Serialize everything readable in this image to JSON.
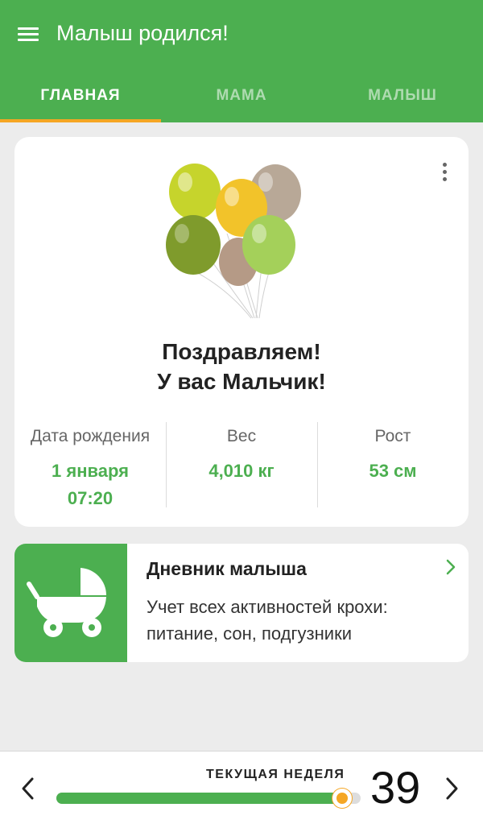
{
  "app": {
    "title": "Малыш родился!"
  },
  "tabs": [
    {
      "label": "ГЛАВНАЯ",
      "active": true
    },
    {
      "label": "МАМА",
      "active": false
    },
    {
      "label": "МАЛЫШ",
      "active": false
    }
  ],
  "birth_card": {
    "congrats_line1": "Поздравляем!",
    "congrats_line2": "У вас Мальчик!",
    "stats": [
      {
        "label": "Дата рождения",
        "value_line1": "1 января",
        "value_line2": "07:20"
      },
      {
        "label": "Вес",
        "value_line1": "4,010 кг"
      },
      {
        "label": "Рост",
        "value_line1": "53 см"
      }
    ]
  },
  "diary": {
    "title": "Дневник малыша",
    "description": "Учет всех активностей крохи: питание, сон, подгузники"
  },
  "week_bar": {
    "label": "ТЕКУЩАЯ НЕДЕЛЯ",
    "week": "39",
    "progress": 0.94
  },
  "colors": {
    "primary": "#4caf50",
    "accent": "#f5a623",
    "background": "#ececec"
  },
  "icons": {
    "menu": "hamburger-icon",
    "more": "kebab-icon",
    "diary": "stroller-icon",
    "chevron": "chevron-right-icon",
    "prev": "chevron-left-icon",
    "next": "chevron-right-icon"
  }
}
